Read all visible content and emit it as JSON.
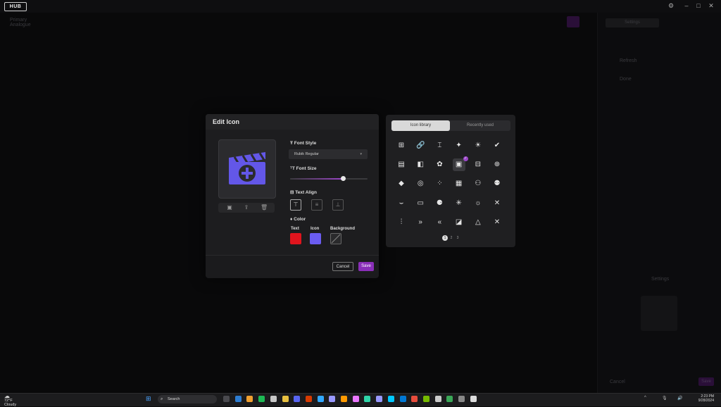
{
  "app": {
    "logo_text": "HUB"
  },
  "window_controls": [
    "⚙",
    "–",
    "□",
    "✕"
  ],
  "background": {
    "top_left_label_1": "Primary",
    "top_left_label_2": "Analogue",
    "right_tab_1": "Settings",
    "right_tab_2": "",
    "right_item_1": "Refresh",
    "right_item_2": "Done",
    "right_settings_title": "Settings",
    "right_footer_cancel": "Cancel",
    "right_footer_save": "Save"
  },
  "dialog": {
    "title": "Edit Icon",
    "font_style_label": "Font Style",
    "font_style_value": "Rubik Regular",
    "font_size_label": "Font Size",
    "font_size_level": 0.68,
    "text_align_label": "Text Align",
    "color_label": "Color",
    "color_text_label": "Text",
    "color_icon_label": "Icon",
    "color_background_label": "Background",
    "colors": {
      "text": "#e0141d",
      "icon": "#6a5cf0",
      "background": "transparent"
    },
    "cancel_label": "Cancel",
    "save_label": "Save",
    "preview_icon": "clapperboard-plus-icon",
    "preview_color": "#6357e8"
  },
  "library": {
    "tabs": [
      {
        "label": "Icon library",
        "active": true
      },
      {
        "label": "Recently used",
        "active": false
      }
    ],
    "icons": [
      "⊞",
      "🔗",
      "⌶",
      "✦",
      "☀",
      "✔",
      "▤",
      "◧",
      "✿",
      "▣",
      "⊟",
      "⊕",
      "◆",
      "◎",
      "⁘",
      "▦",
      "⚇",
      "⚉",
      "⌣",
      "▭",
      "⚈",
      "✳",
      "☼",
      "✕",
      "⫶",
      "»",
      "«",
      "◪",
      "△",
      "✕"
    ],
    "selected_index": 9,
    "pages": [
      "1",
      "2",
      "3"
    ],
    "current_page": "1"
  },
  "taskbar": {
    "weather_temp": "72°F",
    "weather_desc": "Cloudy",
    "search_label": "Search",
    "time": "2:23 PM",
    "date": "9/28/2024"
  }
}
